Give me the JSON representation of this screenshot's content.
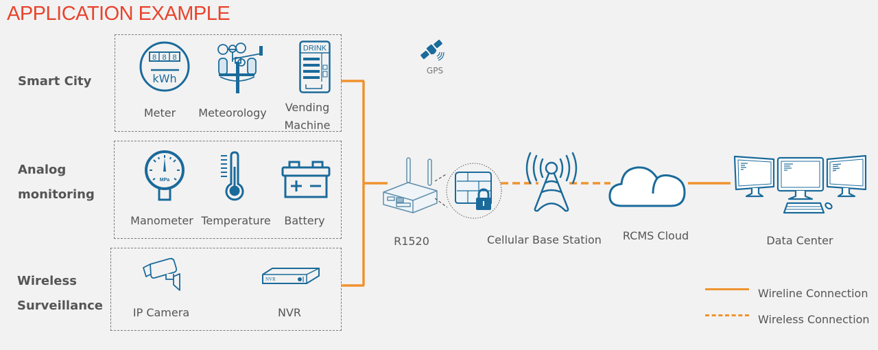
{
  "title": "APPLICATION EXAMPLE",
  "categories": [
    {
      "id": "smart-city",
      "label_lines": [
        "Smart City"
      ],
      "devices": [
        {
          "name": "Meter",
          "icon": "electric-meter-icon",
          "icon_text": [
            "8",
            "8",
            "8",
            "kWh"
          ]
        },
        {
          "name": "Meteorology",
          "icon": "weather-station-icon"
        },
        {
          "name": "Vending Machine",
          "name_lines": [
            "Vending",
            "Machine"
          ],
          "icon": "vending-machine-icon",
          "icon_text": "DRINK"
        }
      ]
    },
    {
      "id": "analog",
      "label_lines": [
        "Analog",
        "monitoring"
      ],
      "devices": [
        {
          "name": "Manometer",
          "icon": "pressure-gauge-icon",
          "icon_text": "MPa"
        },
        {
          "name": "Temperature",
          "icon": "thermometer-icon"
        },
        {
          "name": "Battery",
          "icon": "battery-icon",
          "icon_text": "+ −"
        }
      ]
    },
    {
      "id": "surveillance",
      "label_lines": [
        "Wireless",
        "Surveillance"
      ],
      "devices": [
        {
          "name": "IP Camera",
          "icon": "cctv-camera-icon"
        },
        {
          "name": "NVR",
          "icon": "nvr-device-icon",
          "icon_text": "NVR"
        }
      ]
    }
  ],
  "gps": {
    "label": "GPS",
    "icon": "satellite-icon"
  },
  "router": {
    "label": "R1520",
    "icon": "router-icon",
    "firewall_icon": "firewall-lock-icon"
  },
  "base_station": {
    "label": "Cellular Base Station",
    "icon": "cell-tower-icon"
  },
  "cloud": {
    "label": "RCMS Cloud",
    "icon": "cloud-icon"
  },
  "data_center": {
    "label": "Data Center",
    "icon": "computer-monitors-icon"
  },
  "legend": [
    {
      "label": "Wireline Connection",
      "style": "solid"
    },
    {
      "label": "Wireless Connection",
      "style": "dashed"
    }
  ],
  "colors": {
    "title": "#e8432d",
    "connection": "#f0922e",
    "icon": "#1a6a9a",
    "text": "#555555",
    "background": "#f2f2f2"
  }
}
